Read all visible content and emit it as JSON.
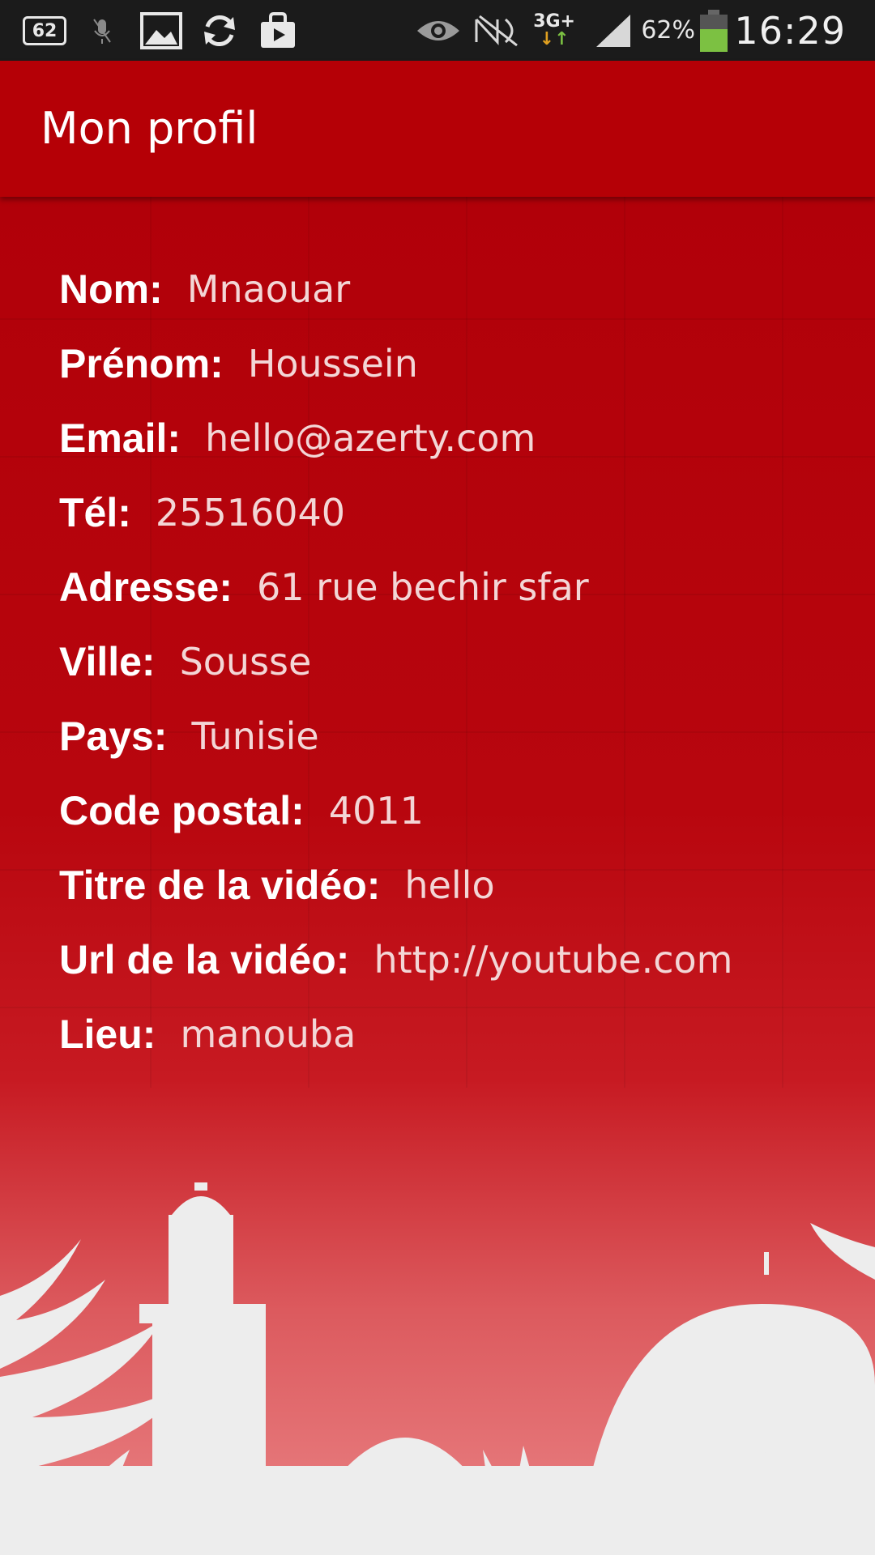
{
  "status_bar": {
    "notification_count": "62",
    "network_type": "3G+",
    "battery_percent": "62%",
    "time": "16:29",
    "icons": [
      "notification-count-icon",
      "mute-mic-icon",
      "image-icon",
      "sync-icon",
      "play-store-icon",
      "eye-icon",
      "nfc-icon",
      "network-3g-icon",
      "signal-icon",
      "battery-icon"
    ]
  },
  "action_bar": {
    "title": "Mon profil"
  },
  "profile": {
    "fields": [
      {
        "label": "Nom:",
        "value": "Mnaouar"
      },
      {
        "label": "Prénom:",
        "value": "Houssein"
      },
      {
        "label": "Email:",
        "value": "hello@azerty.com"
      },
      {
        "label": "Tél:",
        "value": "25516040"
      },
      {
        "label": "Adresse:",
        "value": "61 rue bechir sfar"
      },
      {
        "label": "Ville:",
        "value": "Sousse"
      },
      {
        "label": "Pays:",
        "value": "Tunisie"
      },
      {
        "label": "Code postal:",
        "value": "4011"
      },
      {
        "label": "Titre de la vidéo:",
        "value": "hello"
      },
      {
        "label": "Url de la vidéo:",
        "value": "http://youtube.com"
      },
      {
        "label": "Lieu:",
        "value": "manouba"
      }
    ]
  },
  "colors": {
    "action_bar": "#b50006",
    "background_top": "#b10009",
    "background_bottom": "#ea8486",
    "label_text": "#ffffff",
    "value_text": "#f3d6d6",
    "status_bar": "#1b1b1b"
  }
}
